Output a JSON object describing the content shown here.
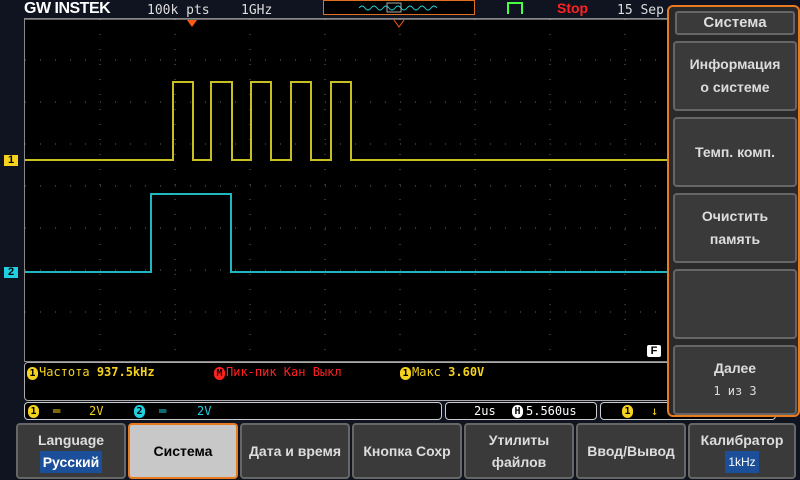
{
  "header": {
    "logo": "GW INSTEK",
    "points": "100k pts",
    "sample_rate": "1GHz",
    "run_state": "Stop",
    "date": "15 Sep"
  },
  "channels": {
    "ch1_marker": "1",
    "ch2_marker": "2",
    "fine_marker": "F"
  },
  "measurements": [
    {
      "badge": "1",
      "label": "Частота",
      "value": "937.5kHz",
      "color": "#f5d21e"
    },
    {
      "badge": "M",
      "label": "Пик-пик Кан Выкл",
      "value": "",
      "color": "#ff2020"
    },
    {
      "badge": "1",
      "label": "Макс",
      "value": "3.60V",
      "color": "#f5d21e"
    }
  ],
  "status": {
    "ch1_badge": "1",
    "ch1_coupling": "DC",
    "ch1_scale": "2V",
    "ch2_badge": "2",
    "ch2_coupling": "DC",
    "ch2_scale": "2V",
    "timebase": "2us",
    "h_badge": "H",
    "h_position": "5.560us",
    "trig_badge": "1",
    "trig_slope": "falling"
  },
  "bottom_menu": [
    {
      "label": "Language",
      "value": "Русский"
    },
    {
      "label": "Система",
      "selected": true
    },
    {
      "label": "Дата и время"
    },
    {
      "label": "Кнопка Сохр"
    },
    {
      "label": "Утилиты",
      "label2": "файлов"
    },
    {
      "label": "Ввод/Вывод"
    },
    {
      "label": "Калибратор",
      "value": "1kHz"
    }
  ],
  "side_menu": {
    "title": "Система",
    "items": [
      {
        "line1": "Информация",
        "line2": "о системе"
      },
      {
        "line1": "Темп. комп.",
        "line2": ""
      },
      {
        "line1": "Очистить",
        "line2": "память"
      },
      {
        "line1": "",
        "line2": ""
      },
      {
        "line1": "Далее",
        "line2": "1 из 3"
      }
    ]
  },
  "colors": {
    "ch1": "#c8c020",
    "ch2": "#20b8c0",
    "accent": "#e87a20"
  }
}
